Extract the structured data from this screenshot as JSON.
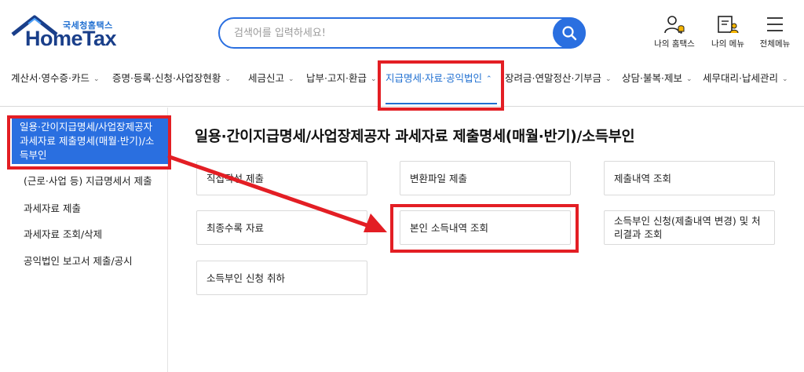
{
  "header": {
    "logo_sub": "국세청홈택스",
    "logo_main": "HomeTax",
    "search_placeholder": "검색어를 입력하세요!",
    "utils": [
      {
        "label": "나의 홈택스",
        "icon": "user-bell-icon"
      },
      {
        "label": "나의 메뉴",
        "icon": "my-menu-icon"
      },
      {
        "label": "전체메뉴",
        "icon": "hamburger-menu-icon"
      }
    ]
  },
  "nav": {
    "items": [
      {
        "label": "계산서·영수증·카드"
      },
      {
        "label": "증명·등록·신청·사업장현황"
      },
      {
        "label": "세금신고"
      },
      {
        "label": "납부·고지·환급"
      },
      {
        "label": "지급명세·자료·공익법인",
        "active": true
      },
      {
        "label": "장려금·연말정산·기부금"
      },
      {
        "label": "상담·불복·제보"
      },
      {
        "label": "세무대리·납세관리"
      }
    ]
  },
  "sidebar": {
    "active_item": "일용·간이지급명세/사업장제공자 과세자료 제출명세(매월·반기)/소득부인",
    "items": [
      "(근로·사업 등) 지급명세서 제출",
      "과세자료 제출",
      "과세자료 조회/삭제",
      "공익법인 보고서 제출/공시"
    ]
  },
  "main": {
    "title": "일용·간이지급명세/사업장제공자 과세자료 제출명세(매월·반기)/소득부인",
    "cards": [
      "직접작성 제출",
      "변환파일 제출",
      "제출내역 조회",
      "최종수록 자료",
      "본인 소득내역 조회",
      "소득부인 신청(제출내역 변경) 및 처리결과 조회",
      "소득부인 신청 취하"
    ]
  },
  "colors": {
    "brand_blue": "#2a6fe0",
    "logo_navy": "#1a3f8a",
    "highlight_red": "#e31e24"
  }
}
